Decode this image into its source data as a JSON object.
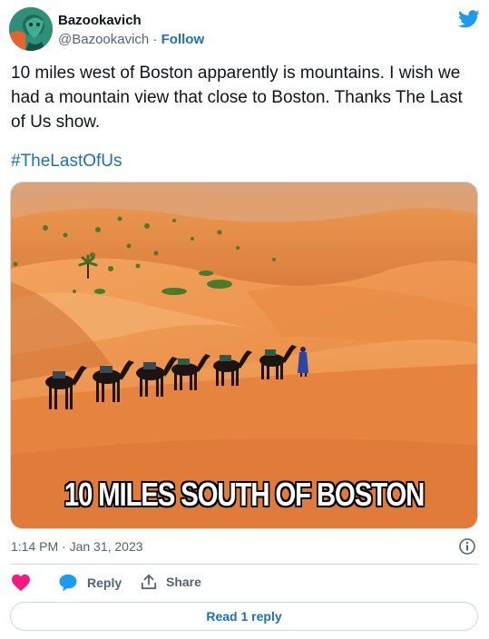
{
  "author": {
    "name": "Bazookavich",
    "handle": "@Bazookavich",
    "separator": "·",
    "follow_label": "Follow"
  },
  "tweet": {
    "text": "10 miles west of Boston apparently is mountains. I wish we had a mountain view that close to Boston. Thanks The Last of Us show.",
    "hashtag": "#TheLastOfUs"
  },
  "media": {
    "caption": "10 MILES SOUTH OF BOSTON"
  },
  "meta": {
    "timestamp": "1:14 PM · Jan 31, 2023"
  },
  "actions": {
    "reply_label": "Reply",
    "share_label": "Share"
  },
  "footer": {
    "read_replies_label": "Read 1 reply"
  },
  "icons": {
    "twitter": "twitter-bird-icon",
    "info": "info-icon",
    "like": "heart-icon",
    "reply": "speech-bubble-icon",
    "share": "share-upload-icon"
  },
  "colors": {
    "link": "#1d6fb8",
    "twitter_blue": "#1d9bf0",
    "like": "#f91880",
    "text": "#0f1419",
    "muted": "#536471"
  }
}
